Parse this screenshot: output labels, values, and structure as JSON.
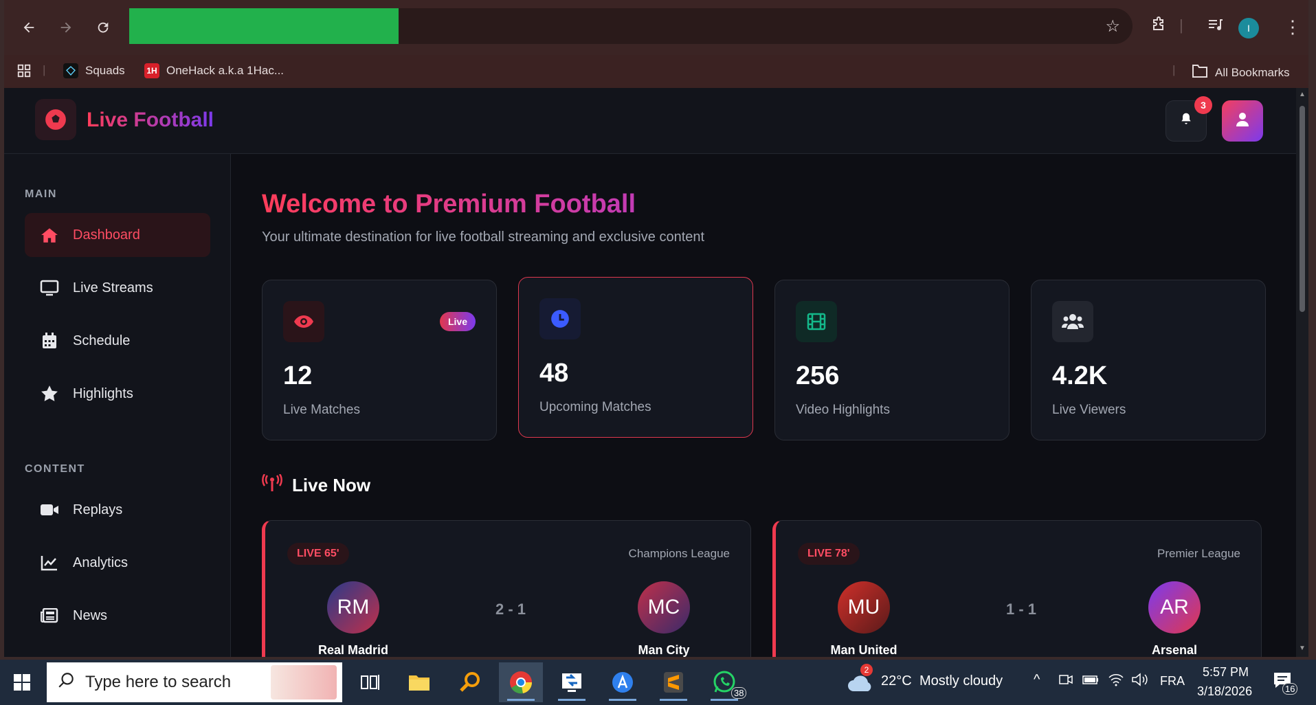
{
  "browser": {
    "bookmarks": [
      {
        "label": "Squads",
        "icon": "diamond-icon"
      },
      {
        "label": "OneHack a.k.a 1Hac...",
        "icon": "onehack-icon",
        "icon_text": "1H"
      }
    ],
    "all_bookmarks_label": "All Bookmarks",
    "profile_initial": "I"
  },
  "app": {
    "title": "Live Football",
    "notifications_count": "3"
  },
  "sidebar": {
    "main_title": "MAIN",
    "main_items": [
      {
        "label": "Dashboard",
        "icon": "home-icon",
        "active": true
      },
      {
        "label": "Live Streams",
        "icon": "monitor-icon"
      },
      {
        "label": "Schedule",
        "icon": "calendar-icon"
      },
      {
        "label": "Highlights",
        "icon": "star-icon"
      }
    ],
    "content_title": "CONTENT",
    "content_items": [
      {
        "label": "Replays",
        "icon": "video-icon"
      },
      {
        "label": "Analytics",
        "icon": "chart-line-icon"
      },
      {
        "label": "News",
        "icon": "newspaper-icon"
      }
    ]
  },
  "main": {
    "welcome": "Welcome to Premium Football",
    "subtitle": "Your ultimate destination for live football streaming and exclusive content",
    "stats": [
      {
        "value": "12",
        "label": "Live Matches",
        "icon": "eye-icon",
        "badge": "Live",
        "accent": "#ef3a4f"
      },
      {
        "value": "48",
        "label": "Upcoming Matches",
        "icon": "clock-icon",
        "accent": "#3b5bff"
      },
      {
        "value": "256",
        "label": "Video Highlights",
        "icon": "film-icon",
        "accent": "#14b88a"
      },
      {
        "value": "4.2K",
        "label": "Live Viewers",
        "icon": "users-icon",
        "accent": "#e5e7eb"
      }
    ],
    "live_now_title": "Live Now",
    "matches": [
      {
        "status": "LIVE 65'",
        "league": "Champions League",
        "home_abbr": "RM",
        "home": "Real Madrid",
        "score": "2 - 1",
        "away_abbr": "MC",
        "away": "Man City"
      },
      {
        "status": "LIVE 78'",
        "league": "Premier League",
        "home_abbr": "MU",
        "home": "Man United",
        "score": "1 - 1",
        "away_abbr": "AR",
        "away": "Arsenal"
      }
    ]
  },
  "taskbar": {
    "search_placeholder": "Type here to search",
    "weather_temp": "22°C",
    "weather_desc": "Mostly cloudy",
    "weather_badge": "2",
    "language": "FRA",
    "time": "5:57 PM",
    "date": "3/18/2026",
    "whatsapp_badge": "38",
    "notifications_badge": "16"
  },
  "colors": {
    "brand_red": "#ef3a4f",
    "brand_purple": "#7c3aed",
    "page_bg": "#0d0e14"
  }
}
